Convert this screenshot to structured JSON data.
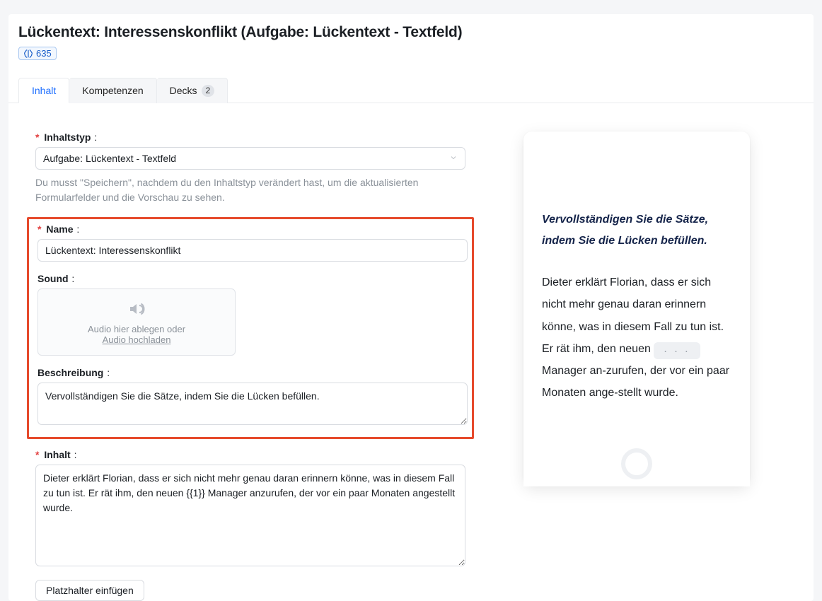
{
  "header": {
    "title": "Lückentext: Interessenskonflikt (Aufgabe: Lückentext - Textfeld)",
    "points": "635"
  },
  "tabs": {
    "inhalt": "Inhalt",
    "kompetenzen": "Kompetenzen",
    "decks": "Decks",
    "decks_count": "2"
  },
  "form": {
    "inhaltstyp_label": "Inhaltstyp",
    "inhaltstyp_value": "Aufgabe: Lückentext - Textfeld",
    "inhaltstyp_help": "Du musst \"Speichern\", nachdem du den Inhaltstyp verändert hast, um die aktualisierten Formularfelder und die Vorschau zu sehen.",
    "name_label": "Name",
    "name_value": "Lückentext: Interessenskonflikt",
    "sound_label": "Sound",
    "audio_drop_text": "Audio hier ablegen oder",
    "audio_upload_link": "Audio hochladen",
    "beschreibung_label": "Beschreibung",
    "beschreibung_value": "Vervollständigen Sie die Sätze, indem Sie die Lücken befüllen.",
    "inhalt_label": "Inhalt",
    "inhalt_value": "Dieter erklärt Florian, dass er sich nicht mehr genau daran erinnern könne, was in diesem Fall zu tun ist. Er rät ihm, den neuen {{1}} Manager anzurufen, der vor ein paar Monaten angestellt wurde.",
    "placeholder_button": "Platzhalter einfügen"
  },
  "preview": {
    "instruction": "Vervollständigen Sie die Sätze, indem Sie die Lücken befüllen.",
    "body_before": "Dieter erklärt Florian, dass er sich nicht mehr genau daran erinnern könne, was in diesem Fall zu tun ist. Er rät ihm, den neuen ",
    "gap_placeholder": ". . .",
    "body_after": " Manager an-zurufen, der vor ein paar Monaten ange-stellt wurde."
  }
}
